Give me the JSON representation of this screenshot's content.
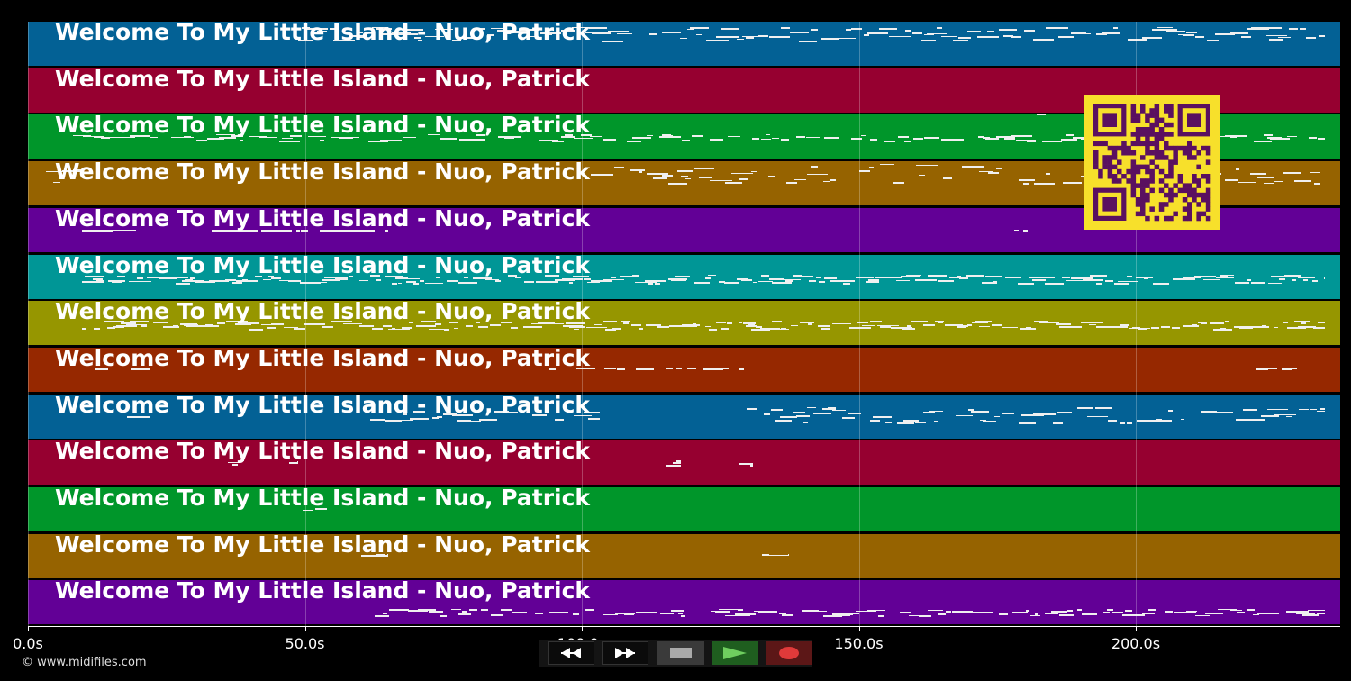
{
  "track_title": "Welcome To My Little Island - Nuo, Patrick",
  "track_colors": [
    "#036195",
    "#960030",
    "#00962a",
    "#966300",
    "#620096",
    "#009696",
    "#969600",
    "#962800",
    "#036195",
    "#960030",
    "#00962a",
    "#966300",
    "#620096"
  ],
  "time_axis": {
    "ticks": [
      {
        "value": 0,
        "label": "0.0s"
      },
      {
        "value": 50,
        "label": "50.0s"
      },
      {
        "value": 100,
        "label": "100.0s"
      },
      {
        "value": 150,
        "label": "150.0s"
      },
      {
        "value": 200,
        "label": "200.0s"
      }
    ],
    "max_seconds": 237
  },
  "qr": {
    "color_bg": "#f7e02b",
    "color_fg": "#5a1060"
  },
  "controls": {
    "rewind_icon": "rewind-icon",
    "forward_icon": "fast-forward-icon",
    "stop_icon": "stop-icon",
    "play_icon": "play-icon",
    "record_icon": "record-icon"
  },
  "copyright": "© www.midifiles.com"
}
